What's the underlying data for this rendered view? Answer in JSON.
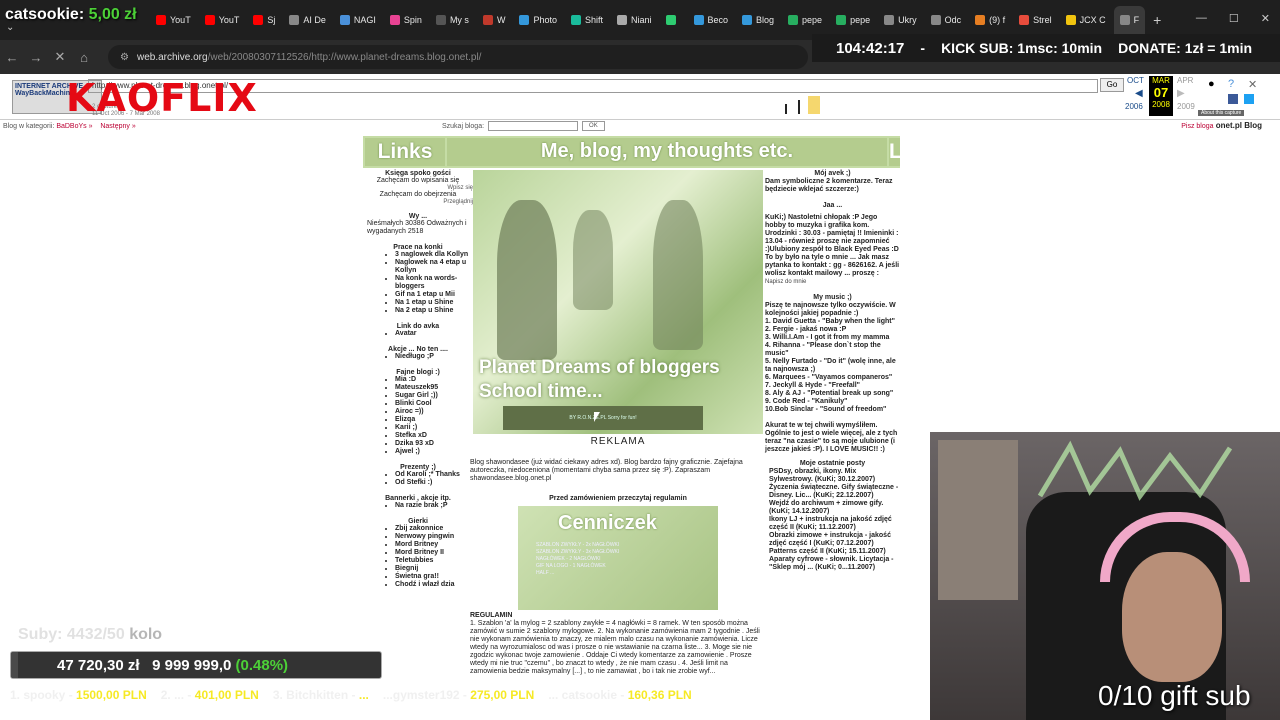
{
  "browser": {
    "tabs": [
      {
        "label": "YouT",
        "color": "#ff0000"
      },
      {
        "label": "YouT",
        "color": "#ff0000"
      },
      {
        "label": "Sj",
        "color": "#ff0000"
      },
      {
        "label": "AI De",
        "color": "#888888"
      },
      {
        "label": "NAGI",
        "color": "#4a90d9"
      },
      {
        "label": "Spin",
        "color": "#e84393"
      },
      {
        "label": "My s",
        "color": "#555555"
      },
      {
        "label": "W",
        "color": "#c0392b"
      },
      {
        "label": "Photo",
        "color": "#3498db"
      },
      {
        "label": "Shift",
        "color": "#1abc9c"
      },
      {
        "label": "Niani",
        "color": "#aaaaaa"
      },
      {
        "label": "",
        "color": "#2ecc71"
      },
      {
        "label": "Beco",
        "color": "#3498db"
      },
      {
        "label": "Blog",
        "color": "#3498db"
      },
      {
        "label": "pepe",
        "color": "#27ae60"
      },
      {
        "label": "pepe",
        "color": "#27ae60"
      },
      {
        "label": "Ukry",
        "color": "#888888"
      },
      {
        "label": "Odc",
        "color": "#888888"
      },
      {
        "label": "(9) f",
        "color": "#e67e22"
      },
      {
        "label": "Strel",
        "color": "#e74c3c"
      },
      {
        "label": "JCX C",
        "color": "#f1c40f"
      },
      {
        "label": "F",
        "color": "#888888"
      }
    ],
    "url_host": "web.archive.org",
    "url_path": "/web/20080307112526/http://www.planet-dreams.blog.onet.pl/"
  },
  "overlays": {
    "catsookie_name": "catsookie:",
    "catsookie_amount": "5,00 zł",
    "timer": "104:42:17",
    "timer_sep": "-",
    "kick_sub": "KICK SUB: 1msc: 10min",
    "donate": "DONATE: 1zł = 1min",
    "kaoflix": "KAOFLIX",
    "subs": "Suby: 4432/50",
    "subs_extra": "kolo",
    "goal_current": "47 720,30 zł",
    "goal_target": "9 999 999,0",
    "goal_pct": "(0.48%)",
    "goal_fraction": 0.0048,
    "gift_sub": "0/10 gift sub",
    "ticker": [
      {
        "name": "1. spooky -",
        "value": "1500,00 PLN"
      },
      {
        "name": "2. ... -",
        "value": "401,00 PLN"
      },
      {
        "name": "3. Bitchkitten -",
        "value": "..."
      },
      {
        "name": "...gymster192 -",
        "value": "275,00 PLN"
      },
      {
        "name": "... catsookie -",
        "value": "160,36 PLN"
      }
    ]
  },
  "wayback": {
    "logo": "INTERNET ARCHIVE WayBackMachine",
    "url_field": "http://www.planet-dreams.blog.onet.pl/",
    "go": "Go",
    "captures": "2 captures",
    "date_range": "11 Oct 2006 - 7 Mar 2008",
    "month_prev": "OCT",
    "month_cur": "MAR",
    "month_next": "APR",
    "day": "07",
    "year_prev": "2006",
    "year_cur": "2008",
    "year_next": "2009",
    "about": "About this capture"
  },
  "onetbar": {
    "category_label": "Blog w kategorii:",
    "category": "BaDBoYs",
    "next": "Następny »",
    "search_label": "Szukaj bloga:",
    "ok": "OK",
    "write_blog": "Pisz bloga",
    "brand": "onet.pl Blog"
  },
  "blog": {
    "links_title": "Links",
    "header_title": "Me, blog, my thoughts etc.",
    "header_edge": "L",
    "left": {
      "guestbook_h": "Księga spoko gości",
      "guestbook_p": "Zachęcam do wpisania się",
      "guestbook_link": "Wpisz się",
      "view_p": "Zachęcam do obejrzenia",
      "view_link": "Przeglądnij",
      "wy_h": "Wy ...",
      "wy_p": "Nieśmałych 30386 Odważnych i wygadanych 2518",
      "prace_h": "Prace na konki",
      "prace": [
        "3 naglowek dla Kollyn",
        "Naglowek na 4 etap u Kollyn",
        "Na konk na words-bloggers",
        "Gif na 1 etap u Mii",
        "Na 1 etap u Shine",
        "Na 2 etap u Shine"
      ],
      "avka_h": "Link do avka",
      "avka": [
        "Avatar"
      ],
      "akcje_h": "Akcje ... No ten ....",
      "akcje": [
        "Niedługo ;P"
      ],
      "fajne_h": "Fajne blogi :)",
      "fajne": [
        "Mia :D",
        "Mateuszek95",
        "Sugar Girl ;))",
        "Blinki Cool",
        "Airoc =))",
        "Elizqa",
        "Karii ;)",
        "Stefka xD",
        "Dzika 93 xD",
        "Ajwel ;)"
      ],
      "prezenty_h": "Prezenty ;)",
      "prezenty": [
        "Od Karoli ;* Thanks",
        "Od Stefki :)"
      ],
      "bannerki_h": "Bannerki , akcje itp.",
      "bannerki": [
        "Na razie brak ;P"
      ],
      "gierki_h": "Gierki",
      "gierki": [
        "Zbij zakonnice",
        "Nerwowy pingwin",
        "Mord Britney",
        "Mord Britney II",
        "Teletubbies",
        "Biegnij",
        "Świetna gra!!",
        "Chodź i wlazł dzia"
      ]
    },
    "banner_title": "Planet Dreams of bloggers",
    "banner_sub": "School time...",
    "banner_strip": "BY R.O.N.ZE.PL Sorry for fun!",
    "center": {
      "reklama": "REKLAMA",
      "para": "Blog shawondasee (już widać ciekawy adres xd). Blog bardzo fajny graficznie. Zajefajna autoreczka, niedoceniona (momentami chyba sama przez się :P). Zapraszam shawondasee.blog.onet.pl",
      "reg_title": "Przed zamówieniem przeczytaj regulamin",
      "cennik_title": "Cenniczek",
      "cennik_lines": "SZABLON ZWYKŁY - 2x NAGŁÓWKI\nSZABLON ZWYKŁY - 3x NAGŁÓWKI\nNAGŁÓWEK - 2 NAGŁÓWKI\nGIF NA LOGO - 1 NAGŁÓWEK\nHALF ...",
      "rules_title": "REGULAMIN",
      "rules": "1. Szablon 'a' la mylog = 2 szablony zwykłe = 4 nagłówki = 8 ramek. W ten sposób można zamówić w sumie 2 szablony mylogowe. 2. Na wykonanie zamówienia mam 2 tygodnie . Jeśli nie wykonam zamówienia to znaczy, ze mialem malo czasu na wykonanie zamówienia. Licze wtedy na wyrozumialosc od was i prosze o nie wstawianie na czarna liste... 3. Moge sie nie zgodzic wykonac twoje zamowienie . Oddaje Ci wtedy komentarze za zamowienie . Prosze wtedy mi nie truc \"czemu\" , bo znaczt to wtedy , że nie mam czasu . 4. Jeśli limit na zamowienia bedzie maksymalny [...] , to nie zamawiat , bo i tak nie zrobie wyf..."
    },
    "right": {
      "moj_h": "Mój avek ;)",
      "moj_p": "Dam symboliczne 2 komentarze. Teraz będziecie wklejać szczerze:)",
      "ja_h": "Jaa ...",
      "ja_p": "KuKi;) Nastoletni chłopak :P Jego hobby to muzyka i grafika kom. Urodzinki : 30.03 - pamiętaj !! Imieninki : 13.04 - również proszę nie zapomnieć :)Ulubiony zespół to Black Eyed Peas :D To by było na tyle o mnie ... Jak masz pytanka to kontakt : gg - 8626162. A jeśli wolisz kontakt mailowy ... proszę :",
      "ja_link": "Napisz do mnie",
      "music_h": "My music ;)",
      "music_p": "Piszę te najnowsze tylko oczywiście. W kolejności jakiej popadnie :)",
      "music": [
        "1. David Guetta - \"Baby when the light\"",
        "2. Fergie - jakaś nowa :P",
        "3. Willi.I.Am - I got it from my mamma",
        "4. Rihanna - \"Please don`t stop the music\"",
        "5. Nelly Furtado - \"Do it\" (wolę inne, ale ta najnowsza ;)",
        "6. Marquees - \"Vayamos companeros\"",
        "7. Jeckyll & Hyde - \"Freefall\"",
        "8. Aly & AJ - \"Potential break up song\"",
        "9. Code Red - \"Kanikuly\"",
        "10.Bob Sinclar - \"Sound of freedom\""
      ],
      "music_note": "Akurat te w tej chwili wymyśliłem. Ogólnie to jest o wiele więcej, ale z tych teraz \"na czasie\" to są moje ulubione (i jeszcze jakieś :P). I LOVE MUSIC!! :)",
      "posts_h": "Moje ostatnie posty",
      "posts": [
        "PSDsy, obrazki, ikony. Mix Sylwestrowy. (KuKi; 30.12.2007)",
        "Życzenia świąteczne. Gify świąteczne - Disney. Lic... (KuKi; 22.12.2007)",
        "Wejdź do archiwum + zimowe gify. (KuKi; 14.12.2007)",
        "Ikony LJ + instrukcja na jakość zdjęć część II (KuKi; 11.12.2007)",
        "Obrazki zimowe + instrukcja - jakość zdjęć część I (KuKi; 07.12.2007)",
        "Patterns część II (KuKi; 15.11.2007)",
        "Aparaty cyfrowe - słownik. Licytacja - \"Sklep mój ... (KuKi; 0...11.2007)"
      ]
    }
  }
}
